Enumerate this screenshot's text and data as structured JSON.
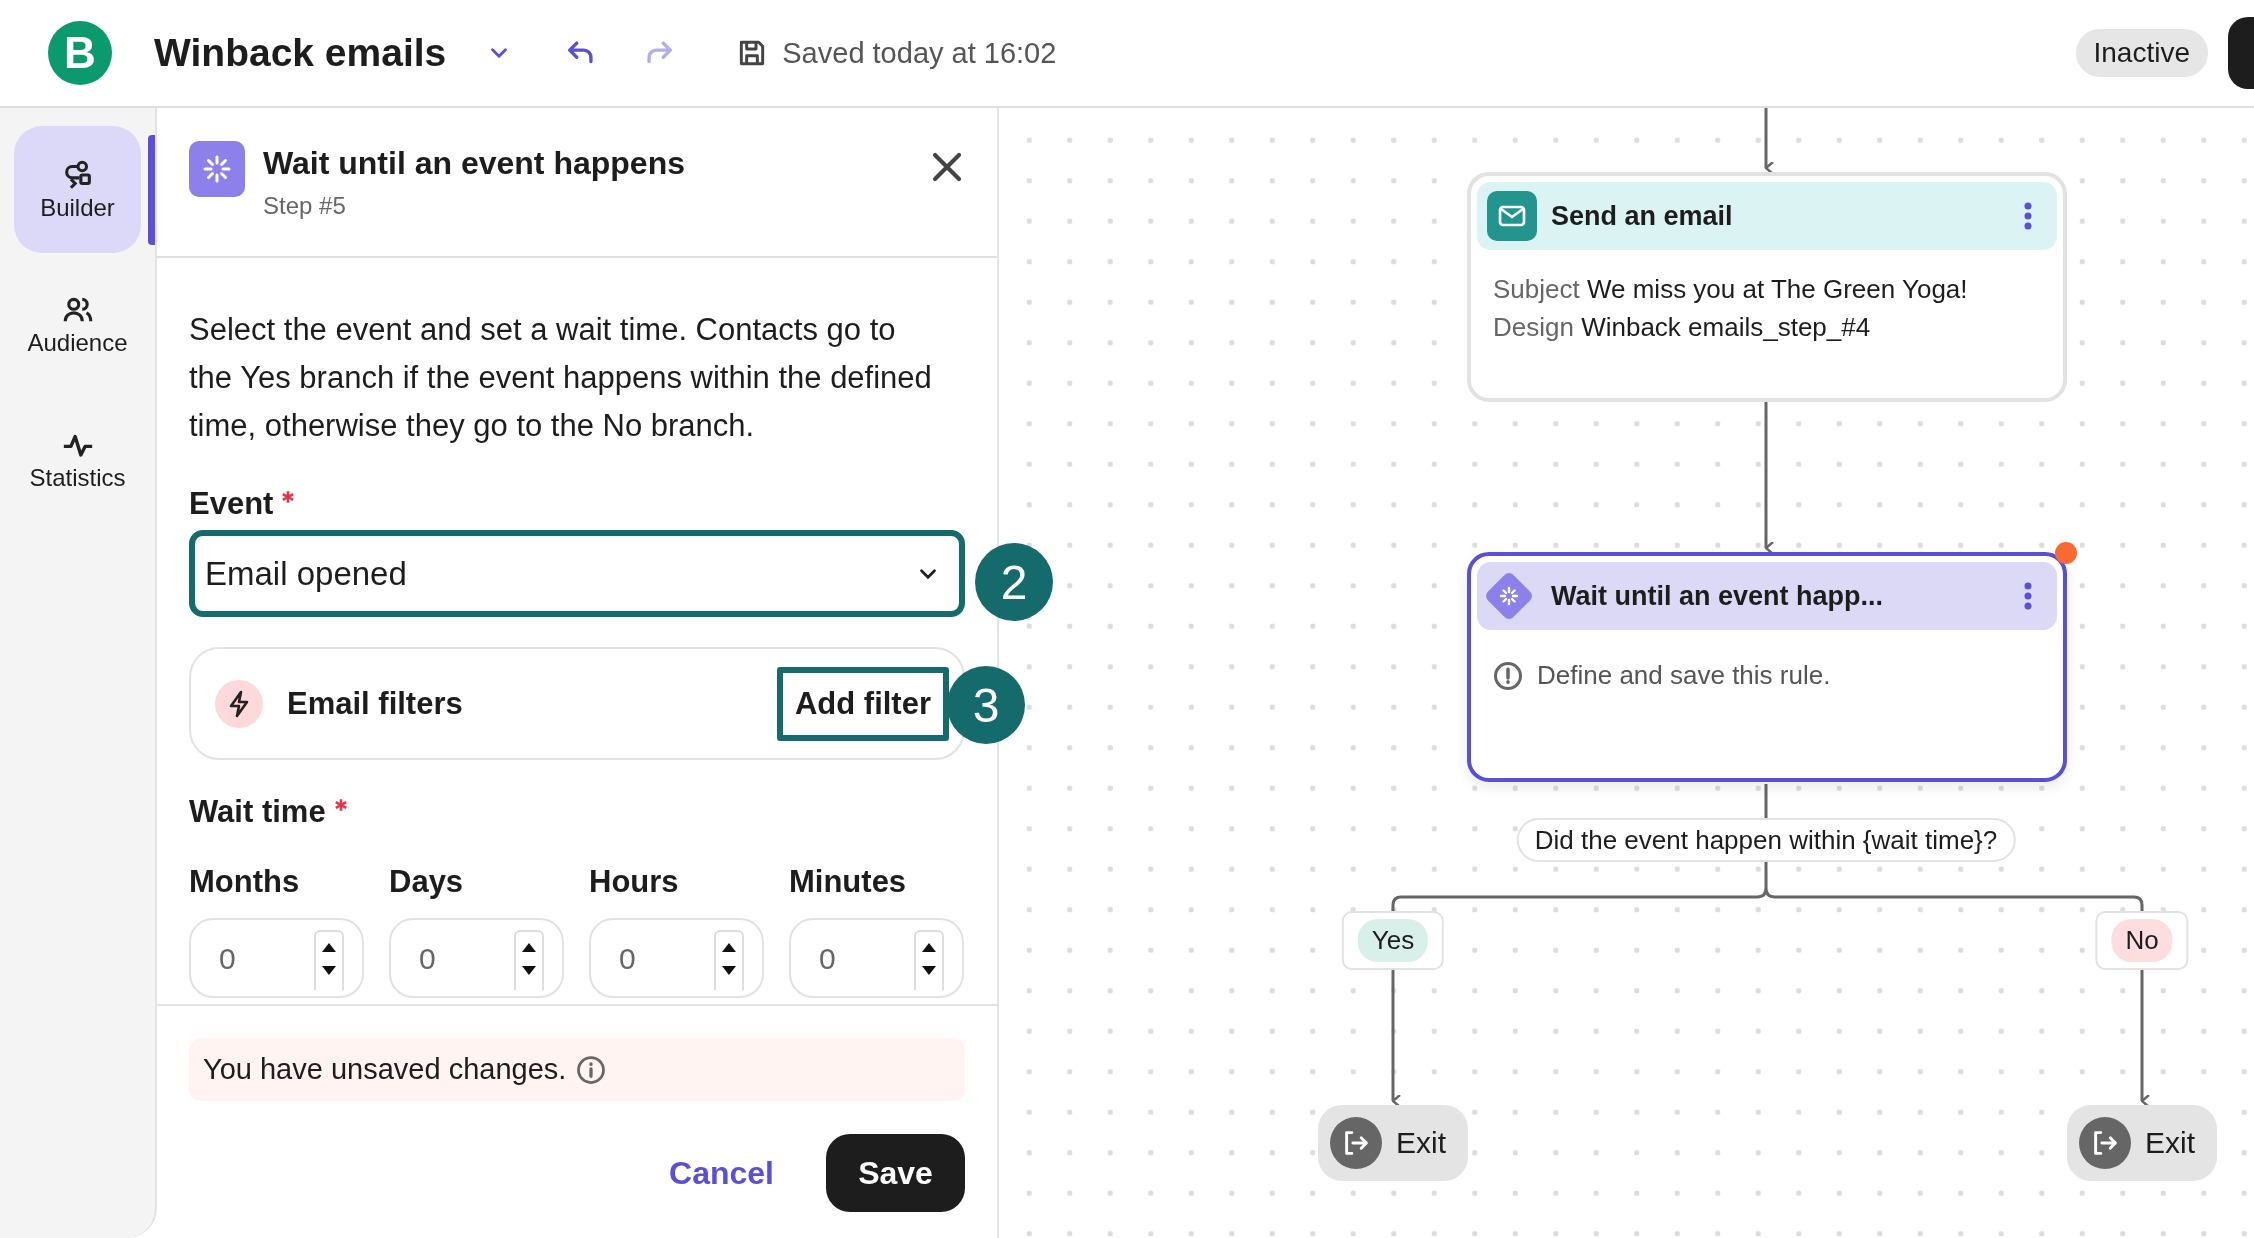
{
  "app": {
    "logo": "B",
    "title": "Winback emails",
    "saved_status": "Saved today at 16:02",
    "status": "Inactive"
  },
  "nav": [
    {
      "label": "Builder",
      "selected": true
    },
    {
      "label": "Audience",
      "selected": false
    },
    {
      "label": "Statistics",
      "selected": false
    }
  ],
  "panel": {
    "title": "Wait until an event happens",
    "step": "Step #5",
    "description": "Select the event and set a wait time. Contacts go to the Yes branch if the event happens within the defined time, otherwise they go to the No branch.",
    "event": {
      "label": "Event",
      "required": true,
      "value": "Email opened",
      "callout": "2"
    },
    "filters": {
      "label": "Email filters",
      "button": "Add filter",
      "callout": "3"
    },
    "wait": {
      "label": "Wait time",
      "required": true,
      "fields": [
        {
          "label": "Months",
          "value": "0"
        },
        {
          "label": "Days",
          "value": "0"
        },
        {
          "label": "Hours",
          "value": "0"
        },
        {
          "label": "Minutes",
          "value": "0"
        }
      ]
    },
    "notice": "You have unsaved changes.",
    "cancel": "Cancel",
    "save": "Save"
  },
  "canvas": {
    "nodes": [
      {
        "kind": "email",
        "title": "Send an email",
        "selected": false,
        "alert": false,
        "lines": [
          {
            "key": "Subject",
            "value": "We miss you at The Green Yoga!"
          },
          {
            "key": "Design",
            "value": "Winback emails_step_#4"
          }
        ]
      },
      {
        "kind": "wait",
        "title": "Wait until an event happ...",
        "selected": true,
        "alert": true,
        "message": "Define and save this rule."
      }
    ],
    "question": "Did the event happen within {wait time}?",
    "branches": [
      {
        "label": "Yes",
        "color": "#d9f0ea",
        "exit": "Exit"
      },
      {
        "label": "No",
        "color": "#fddde0",
        "exit": "Exit"
      }
    ]
  }
}
